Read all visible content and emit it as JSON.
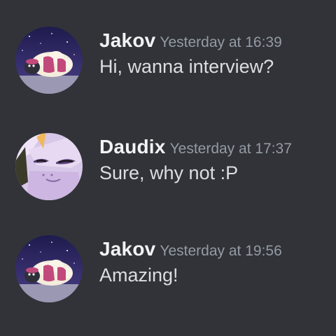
{
  "messages": [
    {
      "author": "Jakov",
      "timestamp": "Yesterday at 16:39",
      "text": "Hi, wanna interview?",
      "avatar_icon": "sheep-avatar-icon"
    },
    {
      "author": "Daudix",
      "timestamp": "Yesterday at 17:37",
      "text": "Sure, why not :P",
      "avatar_icon": "pony-face-avatar-icon"
    },
    {
      "author": "Jakov",
      "timestamp": "Yesterday at 19:56",
      "text": "Amazing!",
      "avatar_icon": "sheep-avatar-icon"
    }
  ],
  "colors": {
    "background": "#313338",
    "author": "#f2f3f5",
    "timestamp": "#949ba4",
    "message_text": "#dbdee1"
  }
}
